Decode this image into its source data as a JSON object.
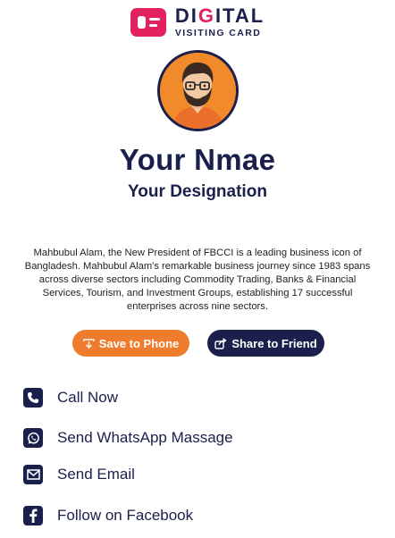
{
  "brand": {
    "title_prefix": "DI",
    "title_accent": "G",
    "title_suffix": "ITAL",
    "subtitle": "VISITING CARD",
    "icon": "id-card-icon",
    "colors": {
      "pink": "#e4215f",
      "navy": "#1b1f4b",
      "orange": "#ef7c2c"
    }
  },
  "profile": {
    "name": "Your Nmae",
    "designation": "Your Designation",
    "bio": "Mahbubul Alam, the New President of FBCCI is a leading business icon of Bangladesh. Mahbubul Alam's remarkable business journey since 1983 spans across diverse sectors including Commodity Trading, Banks & Financial Services, Tourism, and Investment Groups, establishing 17 successful enterprises across nine sectors.",
    "avatar": "bearded-man-avatar-icon"
  },
  "buttons": {
    "save_label": "Save to Phone",
    "share_label": "Share to Friend"
  },
  "actions": [
    {
      "label": "Call Now",
      "icon": "phone-icon"
    },
    {
      "label": "Send WhatsApp Massage",
      "icon": "whatsapp-icon"
    },
    {
      "label": "Send Email",
      "icon": "email-icon"
    },
    {
      "label": "Follow on Facebook",
      "icon": "facebook-icon"
    }
  ]
}
